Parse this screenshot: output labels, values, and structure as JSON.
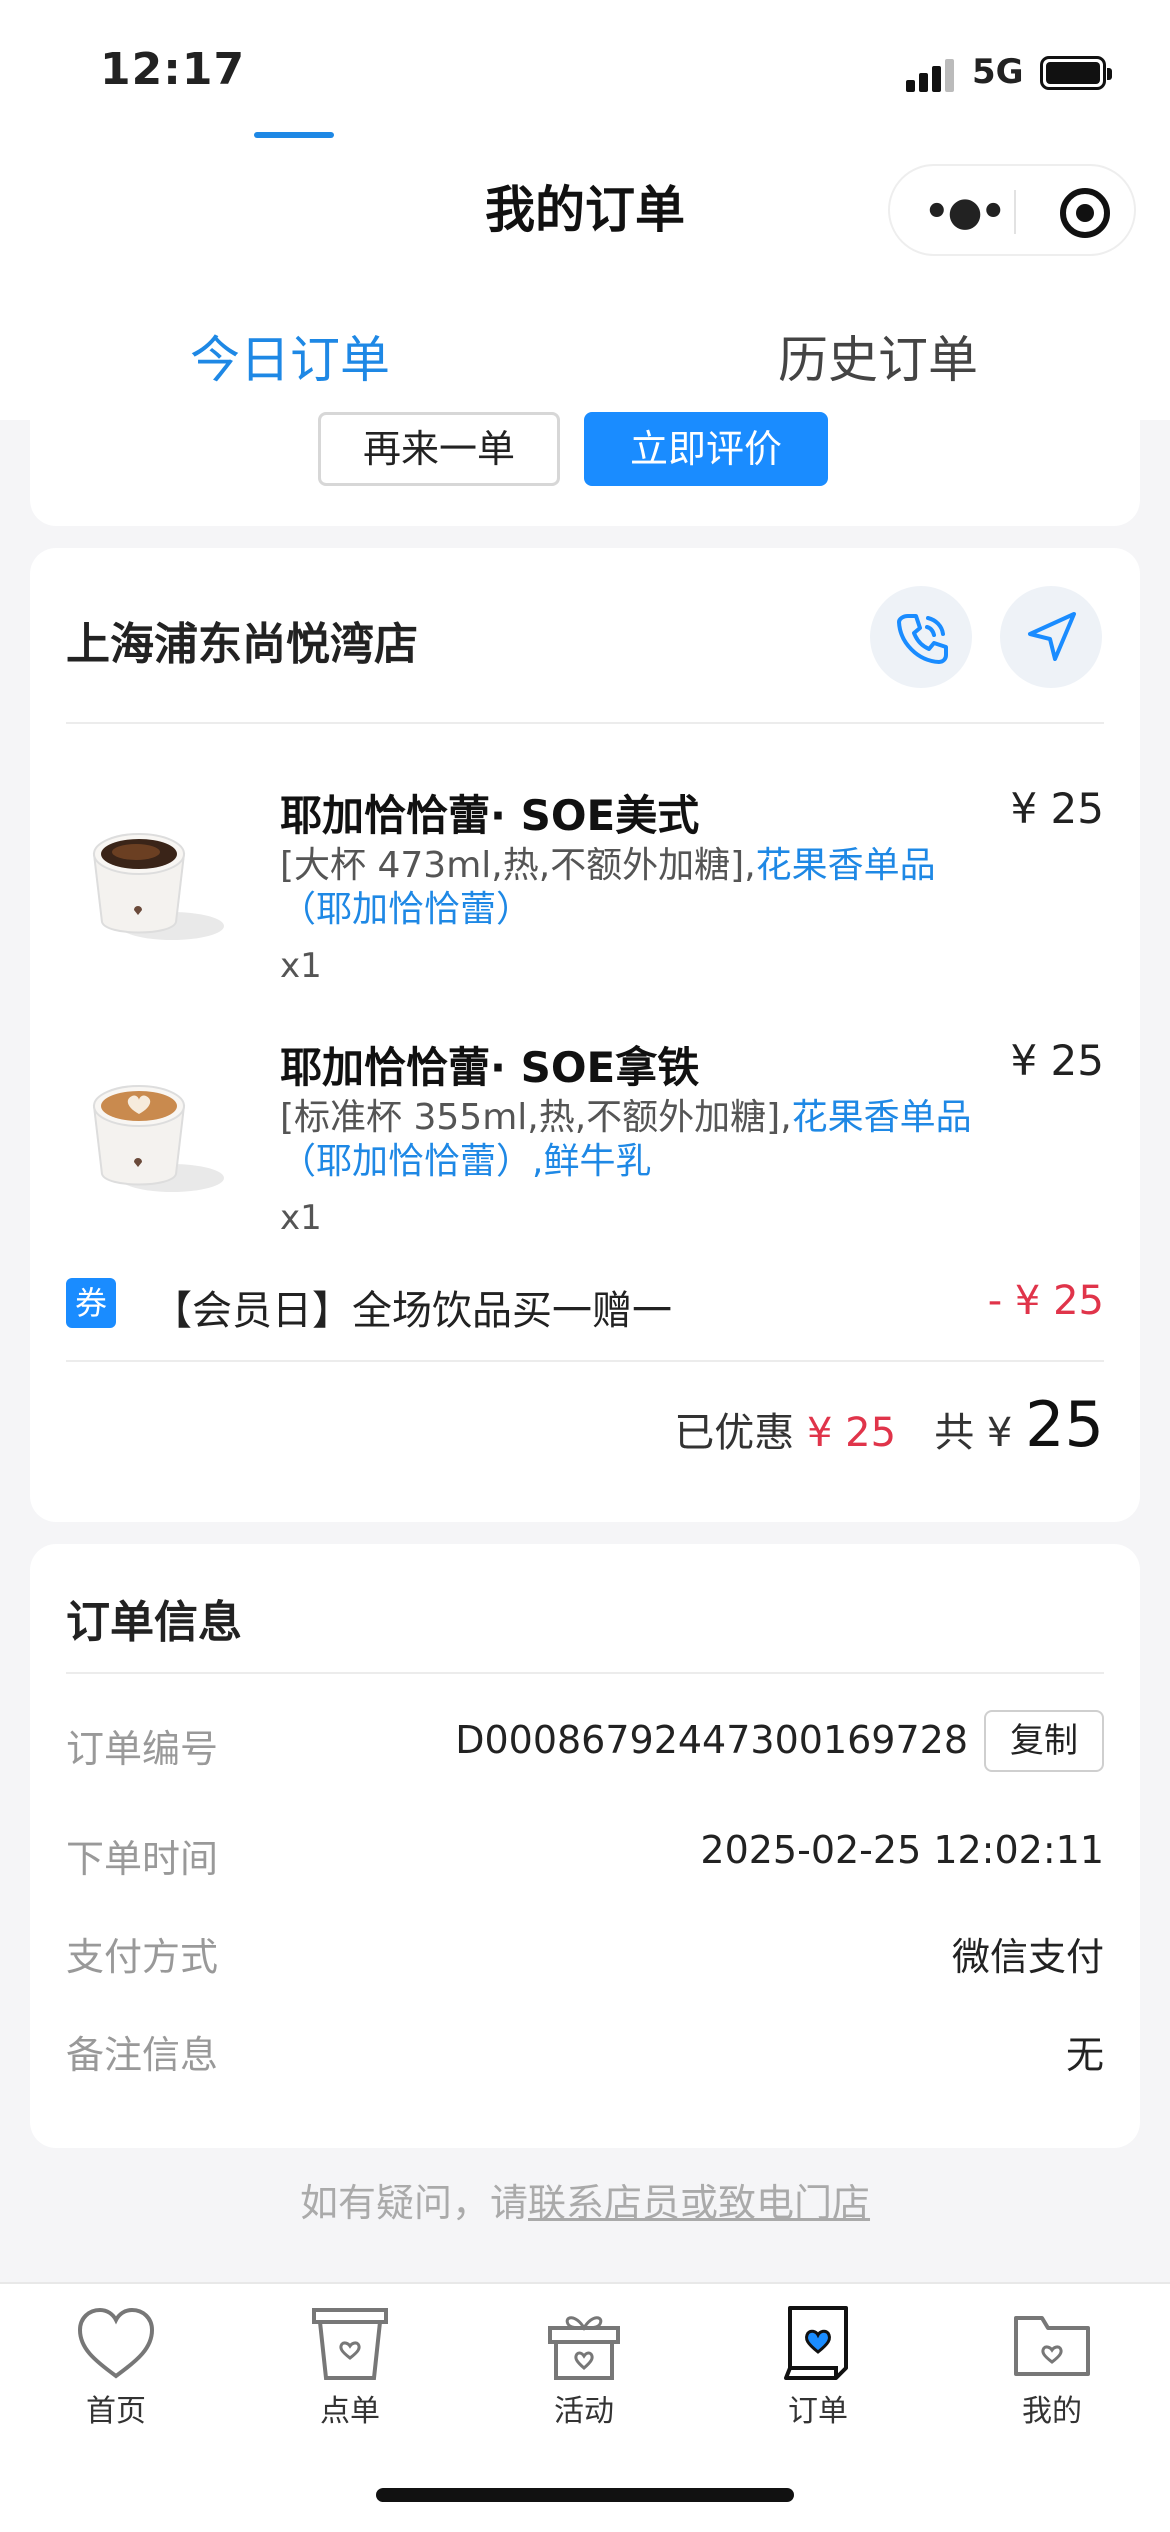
{
  "status_bar": {
    "time": "12:17",
    "network": "5G"
  },
  "nav": {
    "title": "我的订单"
  },
  "tabs": {
    "today": "今日订单",
    "history": "历史订单"
  },
  "actions": {
    "reorder": "再来一单",
    "review": "立即评价"
  },
  "store": {
    "name": "上海浦东尚悦湾店",
    "products": [
      {
        "name": "耶加恰恰蕾· SOE美式",
        "price": "¥ 25",
        "desc_plain": "[大杯 473ml,热,不额外加糖],",
        "desc_highlight": "花果香单品（耶加恰恰蕾）",
        "qty": "x1"
      },
      {
        "name": "耶加恰恰蕾· SOE拿铁",
        "price": "¥ 25",
        "desc_plain": "[标准杯 355ml,热,不额外加糖],",
        "desc_highlight": "花果香单品（耶加恰恰蕾）,鲜牛乳",
        "qty": "x1"
      }
    ],
    "coupon": {
      "badge": "券",
      "text": "【会员日】全场饮品买一赠一",
      "amount": "- ¥ 25"
    },
    "totals": {
      "discount_label": "已优惠",
      "discount_value": "¥ 25",
      "total_label": "共 ¥",
      "total_value": "25"
    }
  },
  "order_info": {
    "title": "订单信息",
    "rows": [
      {
        "label": "订单编号",
        "value": "D0008679244730016972​8"
      },
      {
        "label": "下单时间",
        "value": "2025-02-25 12:02:11"
      },
      {
        "label": "支付方式",
        "value": "微信支付"
      },
      {
        "label": "备注信息",
        "value": "无"
      }
    ],
    "copy_label": "复制"
  },
  "contact": {
    "prefix": "如有疑问，请",
    "link": "联系店员或致电门店"
  },
  "tabbar": [
    "首页",
    "点单",
    "活动",
    "订单",
    "我的"
  ],
  "colors": {
    "accent": "#1a8cff",
    "discount_red": "#e0344a"
  }
}
